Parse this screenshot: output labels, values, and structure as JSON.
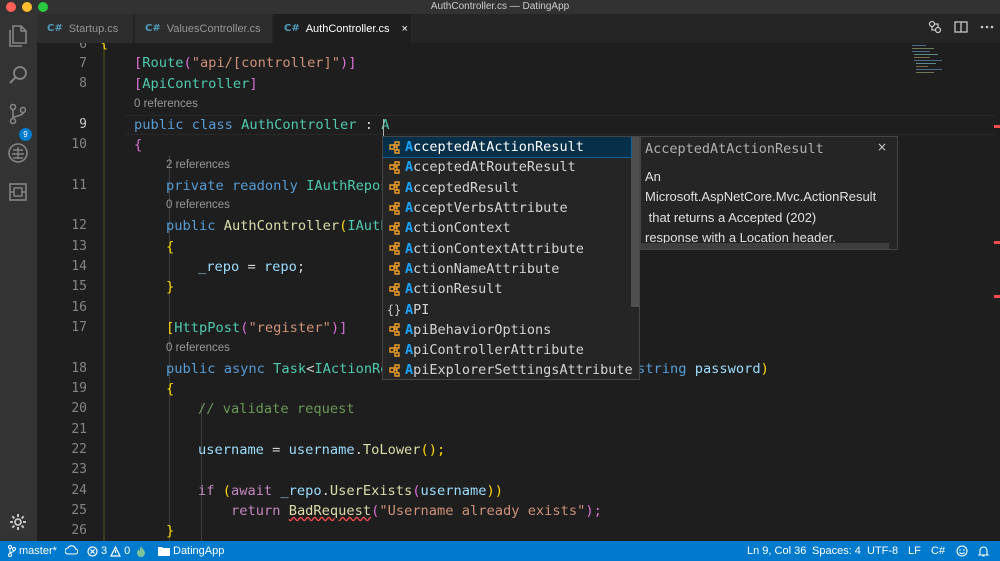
{
  "window": {
    "title": "AuthController.cs — DatingApp"
  },
  "activity": {
    "scm_badge": "9"
  },
  "tabs": [
    {
      "icon": "C#",
      "label": "Startup.cs"
    },
    {
      "icon": "C#",
      "label": "ValuesController.cs"
    },
    {
      "icon": "C#",
      "label": "AuthController.cs",
      "close": "×"
    }
  ],
  "editor": {
    "line_numbers": [
      "6",
      "7",
      "8",
      "9",
      "10",
      "11",
      "12",
      "13",
      "14",
      "15",
      "16",
      "17",
      "18",
      "19",
      "20",
      "21",
      "22",
      "23",
      "24",
      "25",
      "26"
    ],
    "lenses": [
      "0 references",
      "2 references",
      "0 references",
      "0 references"
    ],
    "lines": {
      "l6": "{",
      "l7a": "[",
      "l7b": "Route",
      "l7c": "(",
      "l7d": "\"api/[controller]\"",
      "l7e": ")]",
      "l8a": "[",
      "l8b": "ApiController",
      "l8c": "]",
      "l9a": "public",
      "l9b": "class",
      "l9c": "AuthController",
      "l9d": ":",
      "l9e": "A",
      "l10": "{",
      "l11a": "private",
      "l11b": "readonly",
      "l11c": "IAuthRepos",
      "l12a": "public",
      "l12b": "AuthController",
      "l12c": "(",
      "l12d": "IAuth",
      "l13": "{",
      "l14a": "_repo",
      "l14b": " = ",
      "l14c": "repo",
      "l14d": ";",
      "l15": "}",
      "l17a": "[",
      "l17b": "HttpPost",
      "l17c": "(",
      "l17d": "\"register\"",
      "l17e": ")]",
      "l18a": "public",
      "l18b": "async",
      "l18c": "Task",
      "l18d": "<",
      "l18e": "IActionRe",
      "l18f": "string",
      "l18g": "password",
      "l18h": ")",
      "l19": "{",
      "l20": "// validate request",
      "l22a": "username",
      "l22b": " = ",
      "l22c": "username",
      "l22d": ".",
      "l22e": "ToLower",
      "l22f": "();",
      "l24a": "if",
      "l24b": " (",
      "l24c": "await",
      "l24d": "_repo",
      "l24e": ".",
      "l24f": "UserExists",
      "l24g": "(",
      "l24h": "username",
      "l24i": "))",
      "l25a": "return",
      "l25b": "BadRequest",
      "l25c": "(",
      "l25d": "\"Username already exists\"",
      "l25e": ");",
      "l26": "}"
    }
  },
  "suggest": {
    "items": [
      {
        "hl": "A",
        "rest": "cceptedAtActionResult",
        "kind": "class"
      },
      {
        "hl": "A",
        "rest": "cceptedAtRouteResult",
        "kind": "class"
      },
      {
        "hl": "A",
        "rest": "cceptedResult",
        "kind": "class"
      },
      {
        "hl": "A",
        "rest": "cceptVerbsAttribute",
        "kind": "class"
      },
      {
        "hl": "A",
        "rest": "ctionContext",
        "kind": "class"
      },
      {
        "hl": "A",
        "rest": "ctionContextAttribute",
        "kind": "class"
      },
      {
        "hl": "A",
        "rest": "ctionNameAttribute",
        "kind": "class"
      },
      {
        "hl": "A",
        "rest": "ctionResult",
        "kind": "class"
      },
      {
        "hl": "A",
        "rest": "PI",
        "kind": "namespace"
      },
      {
        "hl": "A",
        "rest": "piBehaviorOptions",
        "kind": "class"
      },
      {
        "hl": "A",
        "rest": "piControllerAttribute",
        "kind": "class"
      },
      {
        "hl": "A",
        "rest": "piExplorerSettingsAttribute",
        "kind": "class"
      }
    ],
    "namespace_glyph": "{}",
    "details": {
      "title": "AcceptedAtActionResult",
      "close": "×",
      "body": [
        "An",
        "Microsoft.AspNetCore.Mvc.ActionResult",
        " that returns a Accepted (202)",
        "response with a Location header."
      ]
    }
  },
  "status": {
    "branch": "master*",
    "errors": "3",
    "warnings": "0",
    "folder": "DatingApp",
    "position": "Ln 9, Col 36",
    "spaces": "Spaces: 4",
    "encoding": "UTF-8",
    "eol": "LF",
    "language": "C#"
  },
  "colors": {
    "accent": "#007acc",
    "selected_suggestion": "#062f4a",
    "match_highlight": "#18a3ff",
    "class_icon": "#ee9d28"
  }
}
